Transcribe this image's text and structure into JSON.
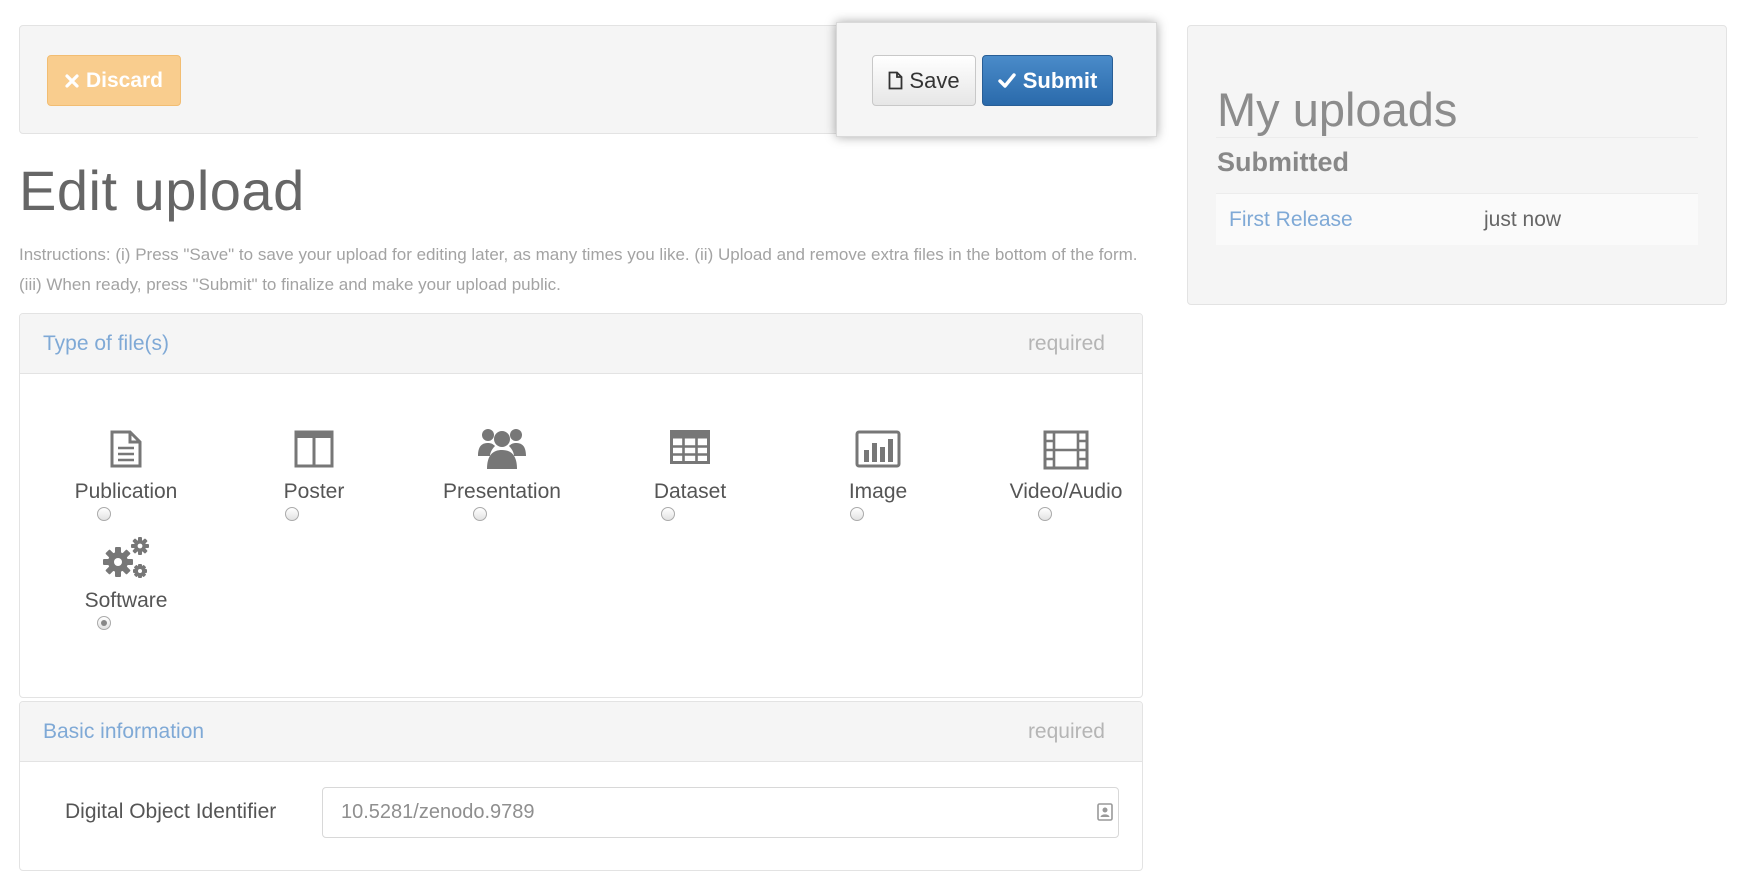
{
  "toolbar": {
    "discard_label": "Discard",
    "save_label": "Save",
    "submit_label": "Submit"
  },
  "page": {
    "title": "Edit upload",
    "instructions": "Instructions: (i) Press \"Save\" to save your upload for editing later, as many times you like. (ii) Upload and remove extra files in the bottom of the form. (iii) When ready, press \"Submit\" to finalize and make your upload public."
  },
  "type_panel": {
    "title": "Type of file(s)",
    "required": "required",
    "types": [
      {
        "label": "Publication",
        "icon": "file-text-icon",
        "selected": false
      },
      {
        "label": "Poster",
        "icon": "columns-icon",
        "selected": false
      },
      {
        "label": "Presentation",
        "icon": "group-icon",
        "selected": false
      },
      {
        "label": "Dataset",
        "icon": "table-icon",
        "selected": false
      },
      {
        "label": "Image",
        "icon": "bar-chart-icon",
        "selected": false
      },
      {
        "label": "Video/Audio",
        "icon": "film-icon",
        "selected": false
      },
      {
        "label": "Software",
        "icon": "gears-icon",
        "selected": true
      }
    ]
  },
  "basic_panel": {
    "title": "Basic information",
    "required": "required",
    "doi_label": "Digital Object Identifier",
    "doi_value": "10.5281/zenodo.9789"
  },
  "sidebar": {
    "title": "My uploads",
    "section": "Submitted",
    "uploads": [
      {
        "name": "First Release",
        "time": "just now"
      }
    ]
  },
  "colors": {
    "link": "#7fa9d6",
    "submit": "#2a6aab",
    "discard": "#f9cd8e"
  }
}
